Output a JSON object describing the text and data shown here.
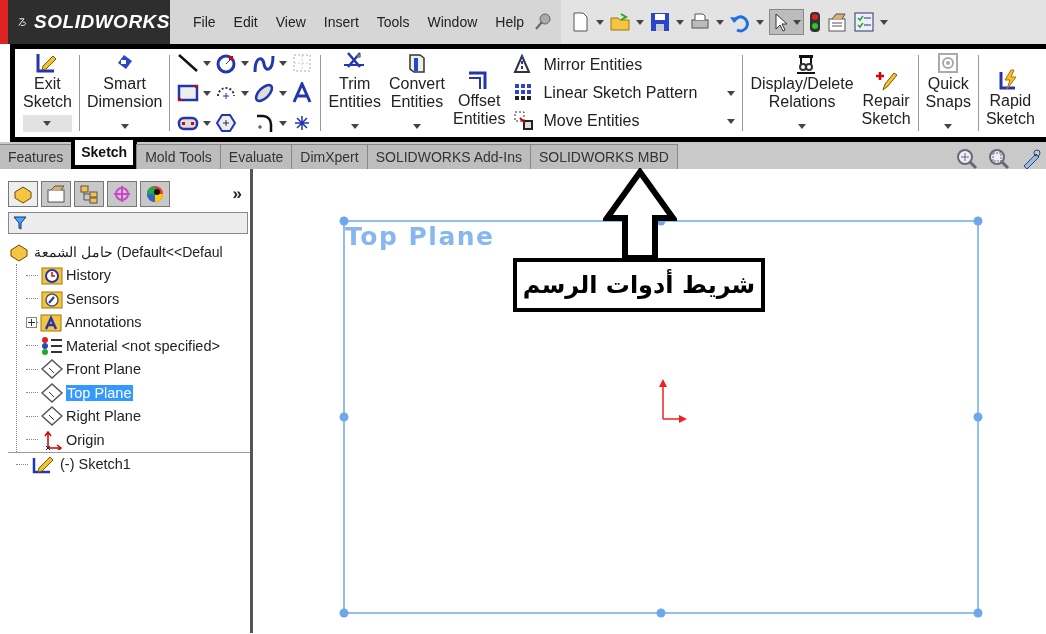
{
  "app": {
    "logo": "SOLIDWORKS"
  },
  "menu": [
    "File",
    "Edit",
    "View",
    "Insert",
    "Tools",
    "Window",
    "Help"
  ],
  "ribbon": {
    "commands": [
      {
        "kind": "large",
        "label": "Exit Sketch",
        "dropdown": true,
        "disabled": false
      },
      {
        "kind": "large",
        "label": "Smart Dimension",
        "dropdown": true,
        "disabled": false
      },
      {
        "kind": "sketch-tools"
      },
      {
        "kind": "large",
        "label": "Trim Entities",
        "dropdown": true,
        "disabled": false
      },
      {
        "kind": "large",
        "label": "Convert Entities",
        "dropdown": true,
        "disabled": false
      },
      {
        "kind": "large",
        "label": "Offset Entities",
        "dropdown": false,
        "disabled": false
      },
      {
        "kind": "list",
        "items": [
          {
            "label": "Mirror Entities",
            "dropdown": false
          },
          {
            "label": "Linear Sketch Pattern",
            "dropdown": true
          },
          {
            "label": "Move Entities",
            "dropdown": true
          }
        ]
      },
      {
        "kind": "large",
        "label": "Display/Delete Relations",
        "dropdown": true,
        "disabled": false
      },
      {
        "kind": "large",
        "label": "Repair Sketch",
        "dropdown": false,
        "disabled": false
      },
      {
        "kind": "large",
        "label": "Quick Snaps",
        "dropdown": true,
        "disabled": true
      },
      {
        "kind": "large",
        "label": "Rapid Sketch",
        "dropdown": false,
        "disabled": false
      }
    ]
  },
  "tabs": [
    {
      "label": "Features",
      "selected": false
    },
    {
      "label": "Sketch",
      "selected": true
    },
    {
      "label": "Mold Tools",
      "selected": false
    },
    {
      "label": "Evaluate",
      "selected": false
    },
    {
      "label": "DimXpert",
      "selected": false
    },
    {
      "label": "SOLIDWORKS Add-Ins",
      "selected": false
    },
    {
      "label": "SOLIDWORKS MBD",
      "selected": false
    }
  ],
  "feature_tree": {
    "more": "»",
    "panel_tabs": [
      {
        "selected": true
      },
      {
        "selected": false
      },
      {
        "selected": false
      },
      {
        "selected": false
      },
      {
        "selected": false
      }
    ],
    "root": "حامل الشمعة  (Default<<Defaul",
    "items": [
      {
        "kind": "history",
        "label": "History",
        "selected": false
      },
      {
        "kind": "sensors",
        "label": "Sensors",
        "selected": false
      },
      {
        "kind": "annotations",
        "label": "Annotations",
        "selected": false,
        "expanded": false
      },
      {
        "kind": "material",
        "label": "Material <not specified>",
        "selected": false
      },
      {
        "kind": "plane",
        "label": "Front Plane",
        "selected": false
      },
      {
        "kind": "plane",
        "label": "Top Plane",
        "selected": true
      },
      {
        "kind": "plane",
        "label": "Right Plane",
        "selected": false
      },
      {
        "kind": "origin",
        "label": "Origin",
        "selected": false
      },
      {
        "kind": "sketch",
        "label": "(-) Sketch1",
        "selected": false
      }
    ]
  },
  "graphics": {
    "plane_label": "Top Plane",
    "callout": "شريط أدوات الرسم"
  }
}
